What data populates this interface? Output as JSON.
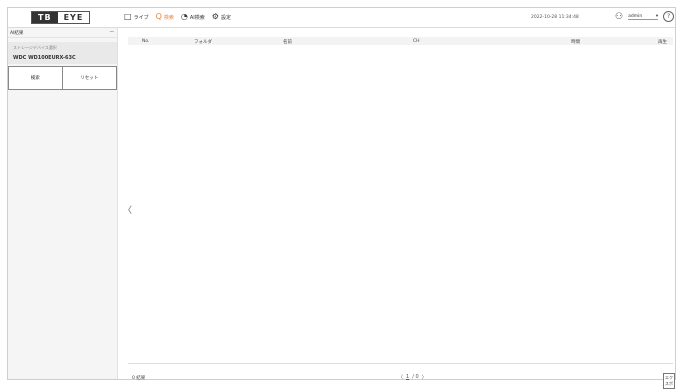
{
  "header": {
    "logo_left": "TB",
    "logo_right": "EYE",
    "nav": [
      {
        "icon": "□",
        "label": "ライブ"
      },
      {
        "icon": "Q",
        "label": "検索"
      },
      {
        "icon": "◔",
        "label": "AI検索"
      },
      {
        "icon": "⚙",
        "label": "設定"
      }
    ],
    "datetime": "2022-10-28 11:34:48",
    "user": "admin",
    "user_caret": "▾",
    "help": "?"
  },
  "sidebar": {
    "title": "AI結果",
    "collapse": "—",
    "drive_label": "ストレージデバイス選択",
    "drive_name": "WDC WD100EURX-63C",
    "search_button": "検索",
    "reset_button": "リセット"
  },
  "table": {
    "columns": [
      "No.",
      "フォルダ",
      "名前",
      "CH",
      "時間",
      "再生"
    ]
  },
  "footer": {
    "results": "0 結果",
    "prev": "〈",
    "current_page": "1",
    "total": "/ 0",
    "next": "〉",
    "export": "エクスポ"
  },
  "collapse_arrow": "〈"
}
